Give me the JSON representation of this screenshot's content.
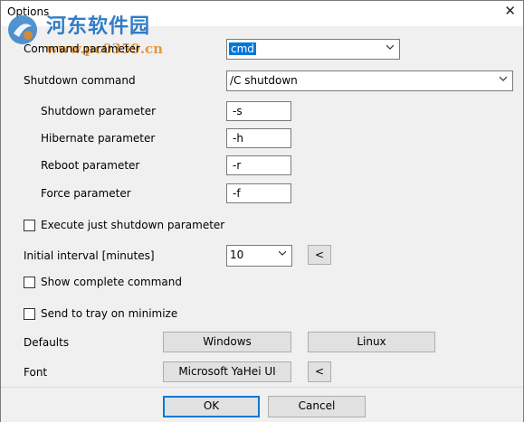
{
  "window": {
    "title": "Options",
    "close_symbol": "✕"
  },
  "watermark": {
    "site_name": "河东软件园",
    "url": "www.pc0359.cn"
  },
  "command_parameter": {
    "label": "Command parameter",
    "value": "cmd"
  },
  "shutdown_command": {
    "label": "Shutdown command",
    "value": "/C shutdown"
  },
  "shutdown_parameter": {
    "label": "Shutdown parameter",
    "value": "-s"
  },
  "hibernate_parameter": {
    "label": "Hibernate parameter",
    "value": "-h"
  },
  "reboot_parameter": {
    "label": "Reboot parameter",
    "value": "-r"
  },
  "force_parameter": {
    "label": "Force parameter",
    "value": "-f"
  },
  "execute_just_shutdown": {
    "label": "Execute just shutdown parameter",
    "checked": false
  },
  "initial_interval": {
    "label": "Initial interval [minutes]",
    "value": "10",
    "button_label": "<"
  },
  "show_complete_command": {
    "label": "Show complete command",
    "checked": false
  },
  "send_to_tray": {
    "label": "Send to tray on minimize",
    "checked": false
  },
  "defaults": {
    "label": "Defaults",
    "windows_button": "Windows",
    "linux_button": "Linux"
  },
  "font": {
    "label": "Font",
    "value_button": "Microsoft YaHei UI",
    "reset_button": "<"
  },
  "footer": {
    "ok_label": "OK",
    "cancel_label": "Cancel"
  }
}
